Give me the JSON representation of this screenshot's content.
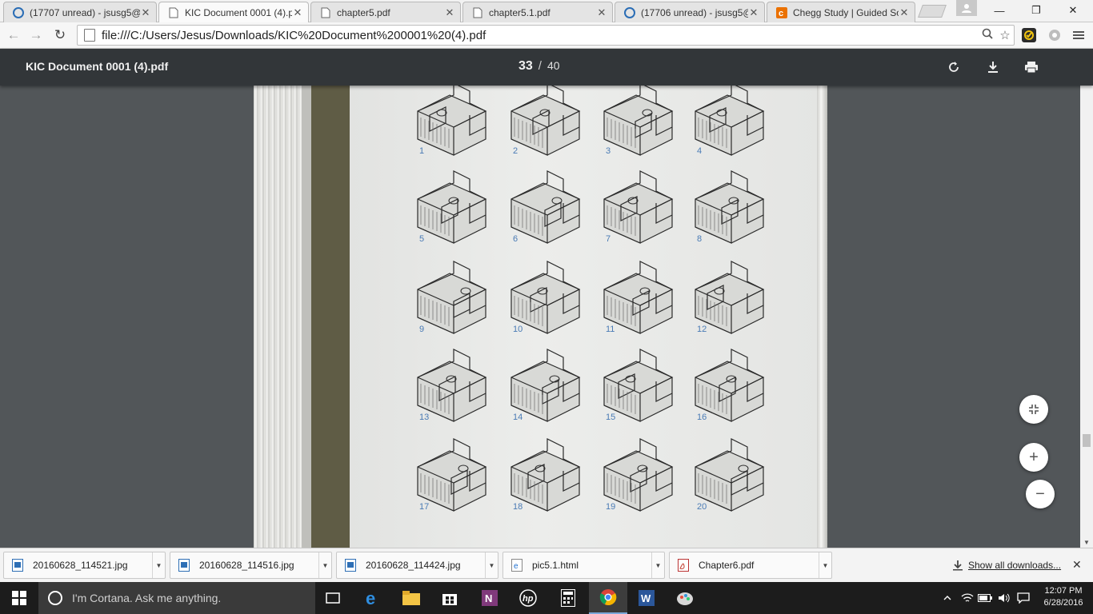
{
  "browser": {
    "tabs": [
      {
        "title": "(17707 unread) - jsusg5@",
        "icon": "yahoo-mail-icon",
        "active": false
      },
      {
        "title": "KIC Document 0001 (4).p",
        "icon": "document-icon",
        "active": true
      },
      {
        "title": "chapter5.pdf",
        "icon": "document-icon",
        "active": false
      },
      {
        "title": "chapter5.1.pdf",
        "icon": "document-icon",
        "active": false
      },
      {
        "title": "(17706 unread) - jsusg5@",
        "icon": "yahoo-mail-icon",
        "active": false
      },
      {
        "title": "Chegg Study | Guided So",
        "icon": "chegg-icon",
        "active": false
      }
    ],
    "url": "file:///C:/Users/Jesus/Downloads/KIC%20Document%200001%20(4).pdf"
  },
  "pdf": {
    "title": "KIC Document 0001 (4).pdf",
    "current_page": "33",
    "page_separator": "/",
    "total_pages": "40",
    "figure_numbers": [
      "1",
      "2",
      "3",
      "4",
      "5",
      "6",
      "7",
      "8",
      "9",
      "10",
      "11",
      "12",
      "13",
      "14",
      "15",
      "16",
      "17",
      "18",
      "19",
      "20"
    ]
  },
  "downloads": {
    "items": [
      {
        "name": "20160628_114521.jpg",
        "type": "image"
      },
      {
        "name": "20160628_114516.jpg",
        "type": "image"
      },
      {
        "name": "20160628_114424.jpg",
        "type": "image"
      },
      {
        "name": "pic5.1.html",
        "type": "html"
      },
      {
        "name": "Chapter6.pdf",
        "type": "pdf"
      }
    ],
    "show_all": "Show all downloads..."
  },
  "taskbar": {
    "cortana_placeholder": "I'm Cortana. Ask me anything.",
    "time": "12:07 PM",
    "date": "6/28/2016"
  },
  "colors": {
    "pdf_toolbar": "#323639",
    "viewer_bg": "#525659",
    "figure_number": "#4a7bb5",
    "taskbar": "#1c1c1c"
  }
}
